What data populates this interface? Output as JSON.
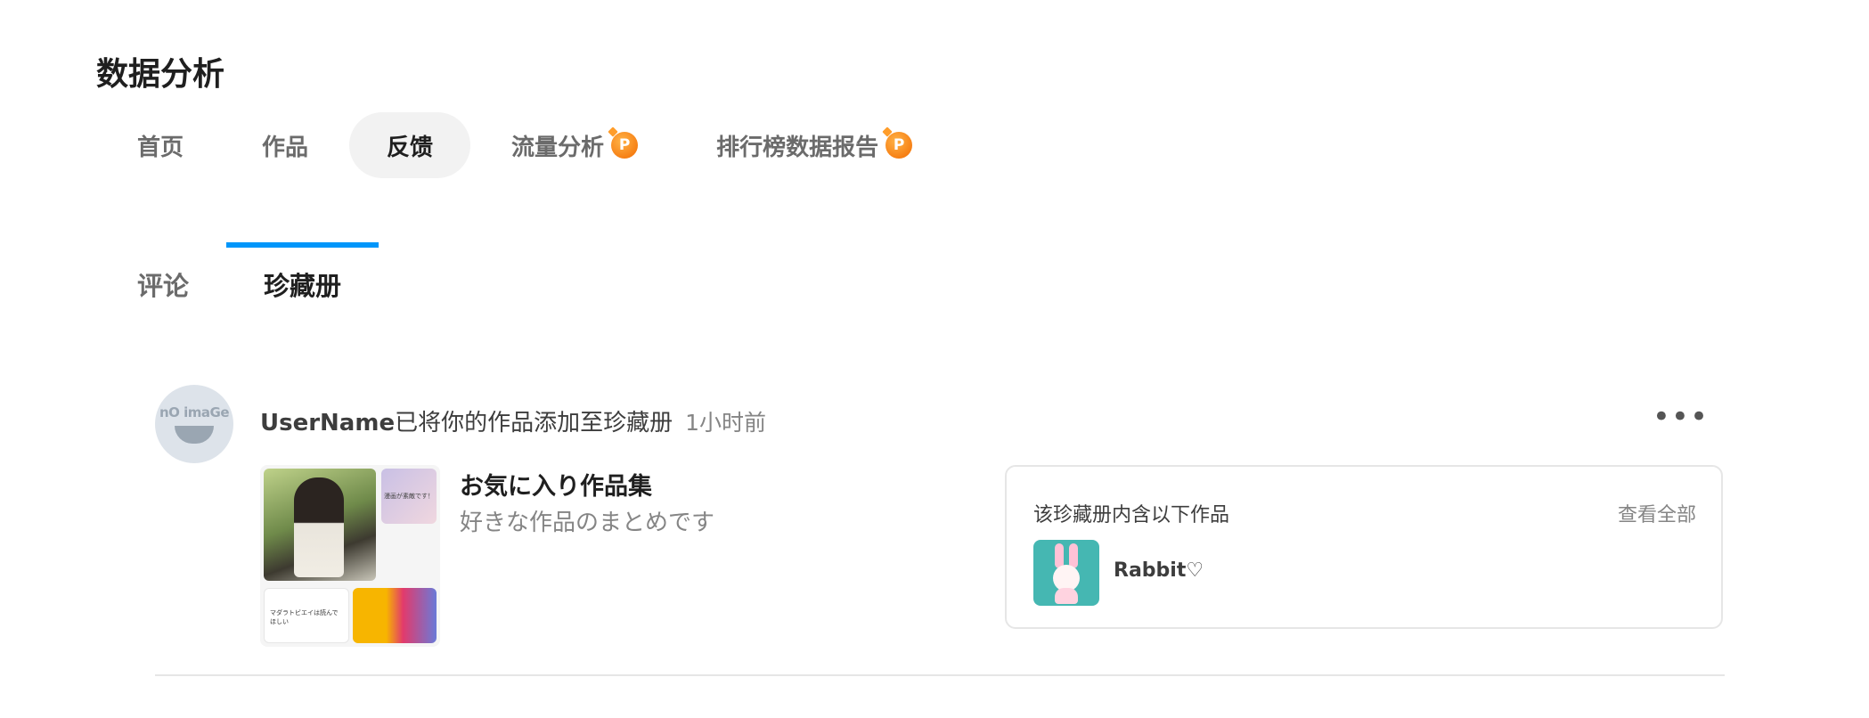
{
  "page": {
    "title": "数据分析"
  },
  "main_tabs": [
    {
      "label": "首页",
      "active": false,
      "premium": false
    },
    {
      "label": "作品",
      "active": false,
      "premium": false
    },
    {
      "label": "反馈",
      "active": true,
      "premium": false
    },
    {
      "label": "流量分析",
      "active": false,
      "premium": true
    },
    {
      "label": "排行榜数据报告",
      "active": false,
      "premium": true
    }
  ],
  "premium_badge": "P",
  "sub_tabs": [
    {
      "label": "评论",
      "active": false
    },
    {
      "label": "珍藏册",
      "active": true
    }
  ],
  "feed_item": {
    "avatar_text": "nO imaGe",
    "user": "UserName",
    "action": "已将你的作品添加至珍藏册",
    "time": "1小时前",
    "more": "•••",
    "collection": {
      "title": "お気に入り作品集",
      "description": "好きな作品のまとめです",
      "thumb_caption_a": "漫画が素敵です！",
      "thumb_caption_b": "マダラトビエイは読んでほしい"
    },
    "includes": {
      "heading": "该珍藏册内含以下作品",
      "view_all": "查看全部",
      "works": [
        {
          "title": "Rabbit♡"
        }
      ]
    }
  },
  "colors": {
    "accent": "#0096fa",
    "premium": "#f36b00",
    "tab_active_bg": "#f2f2f2"
  }
}
